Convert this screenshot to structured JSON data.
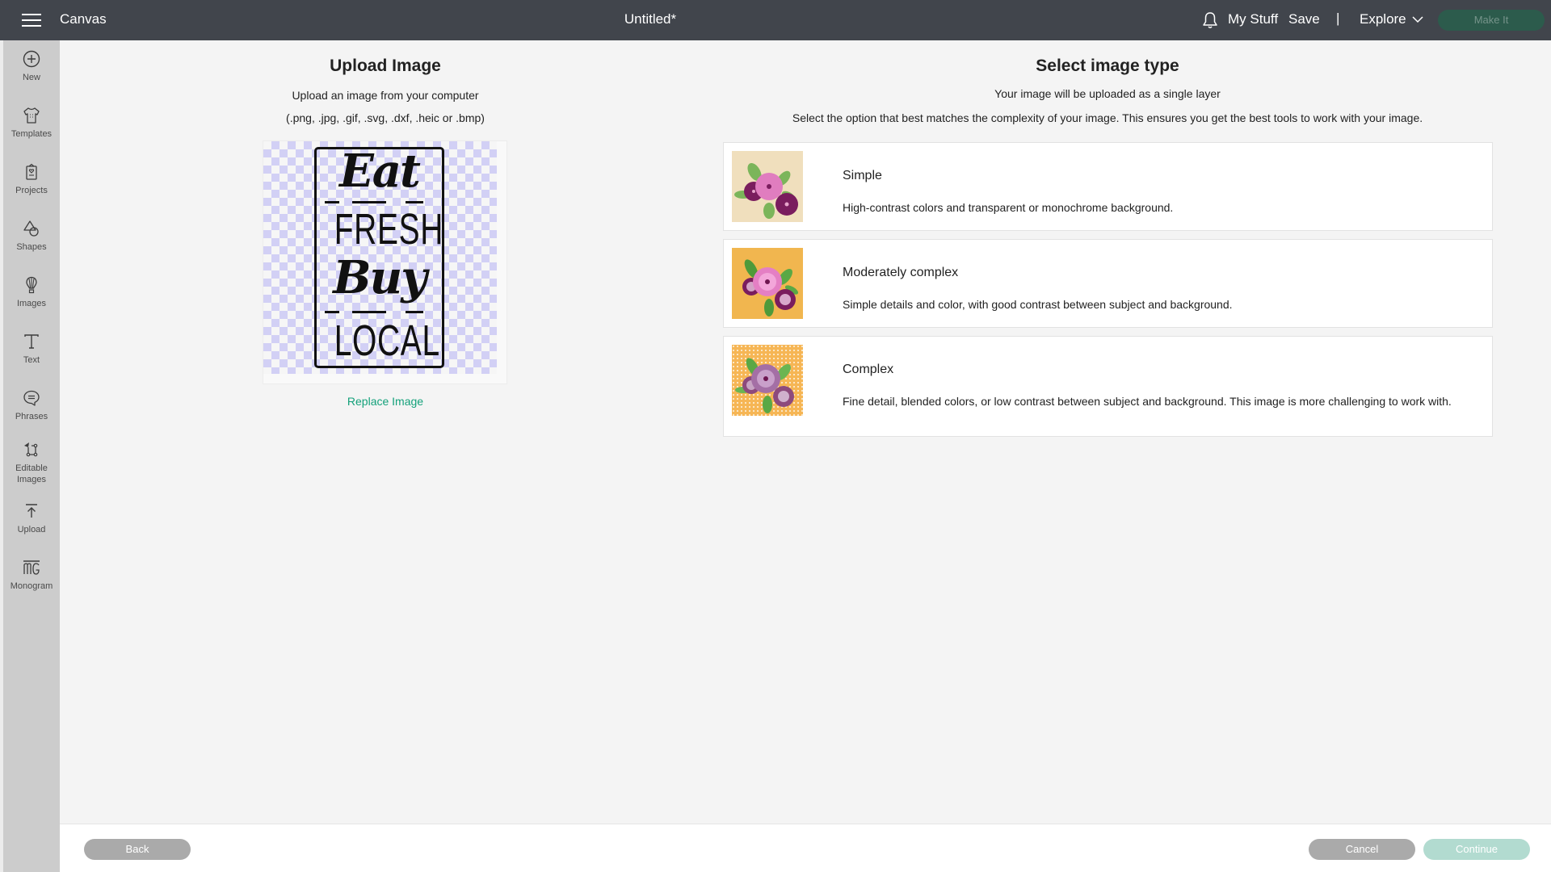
{
  "header": {
    "app_name": "Canvas",
    "doc_title": "Untitled*",
    "icons": {
      "menu": "hamburger-icon",
      "notifications": "bell-icon",
      "explore_dropdown": "chevron-down-icon"
    },
    "my_stuff_label": "My Stuff",
    "save_label": "Save",
    "separator": "|",
    "explore_label": "Explore",
    "make_it_label": "Make It"
  },
  "sidebar": {
    "items": [
      {
        "label": "New",
        "icon": "plus-circle-icon"
      },
      {
        "label": "Templates",
        "icon": "tshirt-icon"
      },
      {
        "label": "Projects",
        "icon": "card-heart-icon"
      },
      {
        "label": "Shapes",
        "icon": "shapes-icon"
      },
      {
        "label": "Images",
        "icon": "lightbulb-balloon-icon"
      },
      {
        "label": "Text",
        "icon": "text-icon"
      },
      {
        "label": "Phrases",
        "icon": "speech-bubble-icon"
      },
      {
        "label": "Editable Images",
        "label_line1": "Editable",
        "label_line2": "Images",
        "icon": "editable-image-icon"
      },
      {
        "label": "Upload",
        "icon": "upload-arrow-icon"
      },
      {
        "label": "Monogram",
        "icon": "monogram-icon"
      }
    ]
  },
  "upload_panel": {
    "title": "Upload Image",
    "subtitle": "Upload an image from your computer",
    "formats": "(.png, .jpg, .gif, .svg, .dxf, .heic or .bmp)",
    "preview_text": {
      "line1": "Eat",
      "line2": "FRESH",
      "line3": "Buy",
      "line4": "LOCAL"
    },
    "replace_label": "Replace Image"
  },
  "select_panel": {
    "title": "Select image type",
    "subtitle": "Your image will be uploaded as a single layer",
    "instructions": "Select the option that best matches the complexity of your image. This ensures you get the best tools to work with your image.",
    "options": [
      {
        "name": "Simple",
        "description": "High-contrast colors and transparent or monochrome background.",
        "thumb_bg": "#f0dfbd"
      },
      {
        "name": "Moderately complex",
        "description": "Simple details and color, with good contrast between subject and background.",
        "thumb_bg": "#f1b64f"
      },
      {
        "name": "Complex",
        "description": "Fine detail, blended colors, or low contrast between subject and background. This image is more challenging to work with.",
        "thumb_bg": "#f6b655"
      }
    ]
  },
  "footer": {
    "back_label": "Back",
    "cancel_label": "Cancel",
    "continue_label": "Continue"
  },
  "colors": {
    "topbar": "#41454c",
    "accent_green": "#13a17a",
    "make_it_bg": "#2c5b4c",
    "continue_disabled": "#b2dbd0",
    "button_gray": "#aaaaaa"
  }
}
